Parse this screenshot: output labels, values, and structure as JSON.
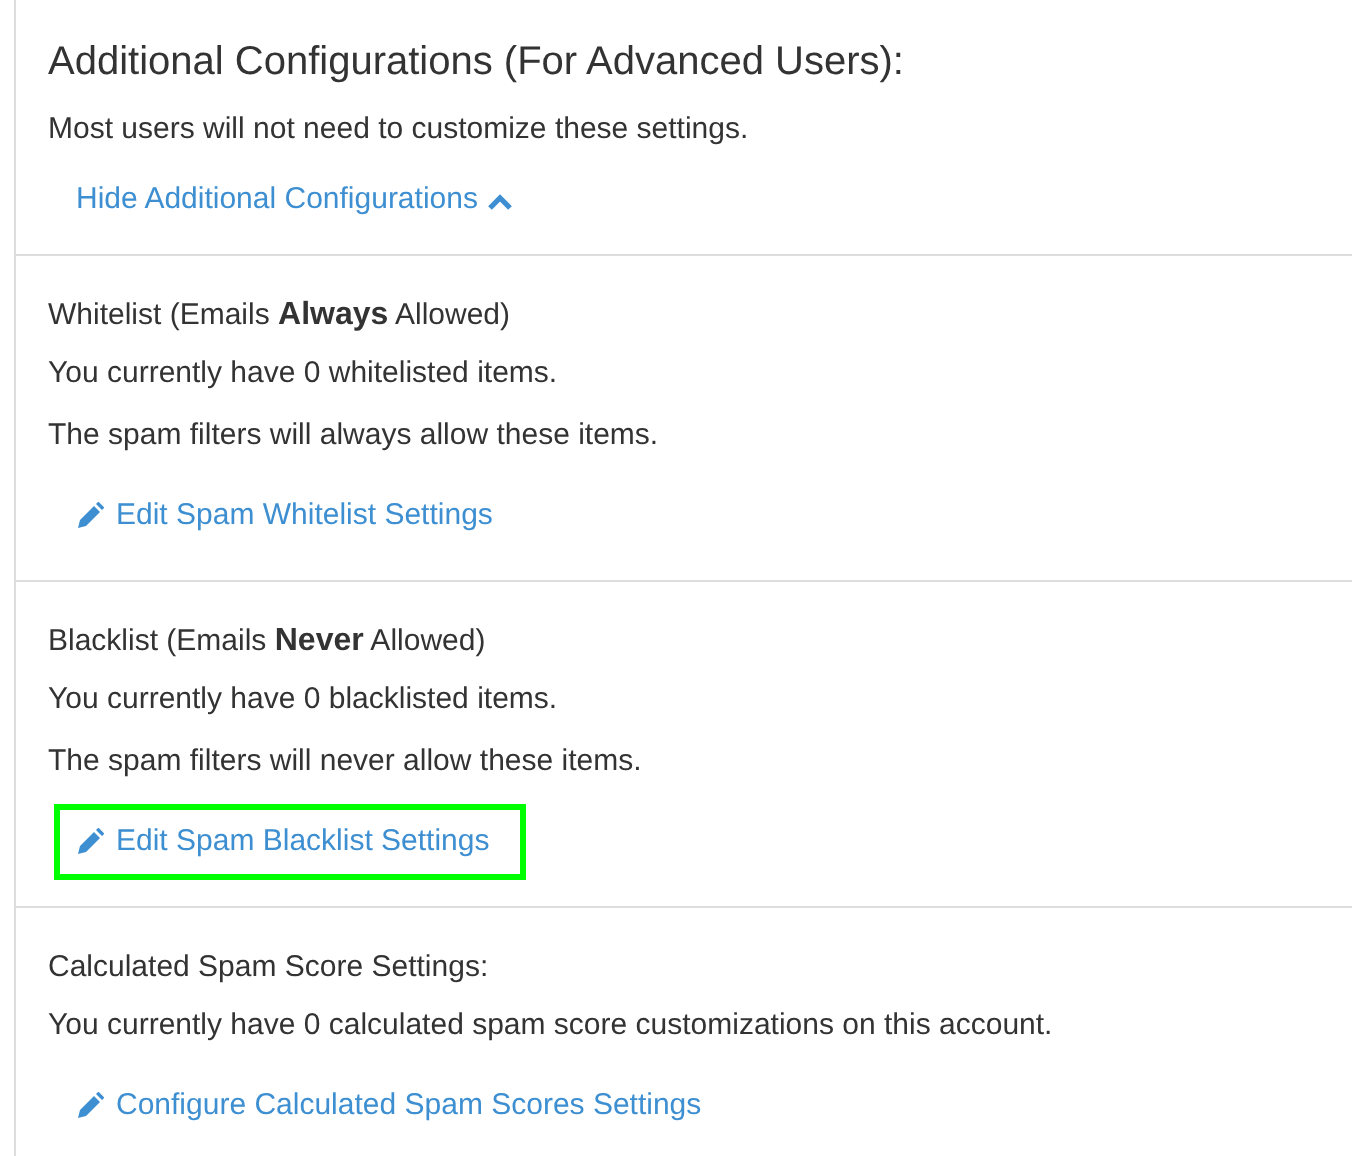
{
  "header": {
    "title": "Additional Configurations (For Advanced Users):",
    "subtitle": "Most users will not need to customize these settings.",
    "toggle_link": "Hide Additional Configurations",
    "expanded": true
  },
  "sections": [
    {
      "title": "Whitelist (Emails **Always** Allowed)",
      "lines": [
        "You currently have 0 whitelisted items.",
        "The spam filters will always allow these items."
      ],
      "link": {
        "label": "Edit Spam Whitelist Settings",
        "highlighted": false
      }
    },
    {
      "title": "Blacklist (Emails **Never** Allowed)",
      "lines": [
        "You currently have 0 blacklisted items.",
        "The spam filters will never allow these items."
      ],
      "link": {
        "label": "Edit Spam Blacklist Settings",
        "highlighted": true
      }
    },
    {
      "title": "Calculated Spam Score Settings:",
      "lines": [
        "You currently have 0 calculated spam score customizations on this account."
      ],
      "link": {
        "label": "Configure Calculated Spam Scores Settings",
        "highlighted": false
      }
    }
  ]
}
